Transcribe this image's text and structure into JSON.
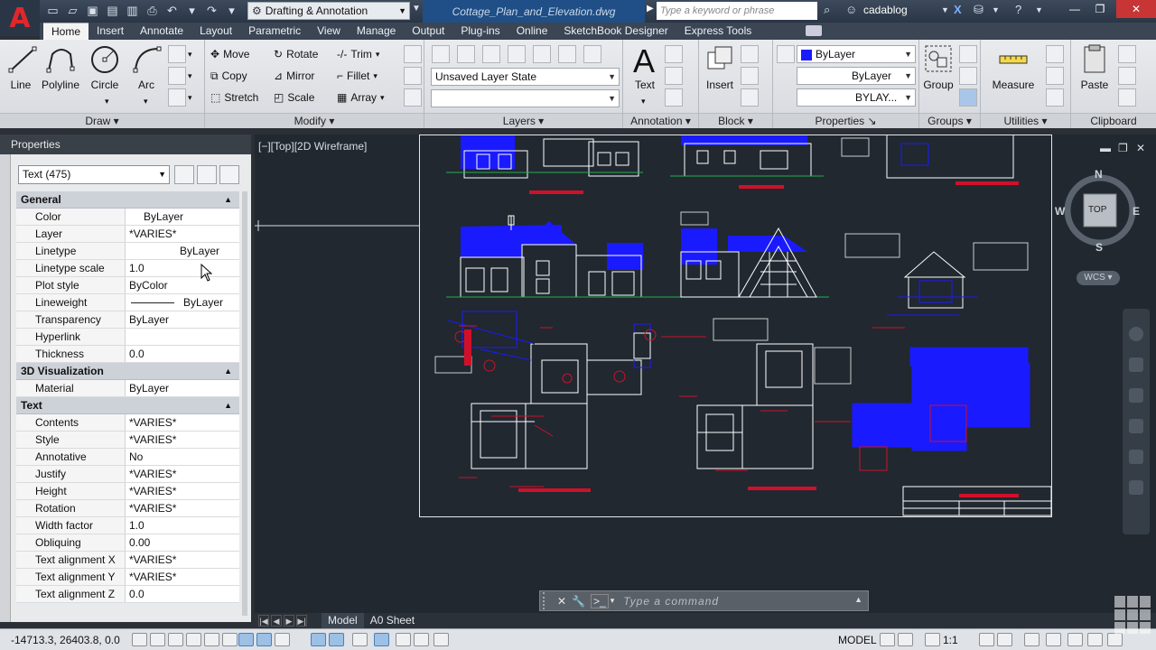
{
  "titlebar": {
    "workspace": "Drafting & Annotation",
    "document": "Cottage_Plan_and_Elevation.dwg",
    "search_placeholder": "Type a keyword or phrase",
    "user": "cadablog"
  },
  "ribbon": {
    "tabs": [
      "Home",
      "Insert",
      "Annotate",
      "Layout",
      "Parametric",
      "View",
      "Manage",
      "Output",
      "Plug-ins",
      "Online",
      "SketchBook Designer",
      "Express Tools"
    ],
    "active_tab": "Home",
    "draw": {
      "title": "Draw",
      "line": "Line",
      "polyline": "Polyline",
      "circle": "Circle",
      "arc": "Arc"
    },
    "modify": {
      "title": "Modify",
      "move": "Move",
      "rotate": "Rotate",
      "trim": "Trim",
      "copy": "Copy",
      "mirror": "Mirror",
      "fillet": "Fillet",
      "stretch": "Stretch",
      "scale": "Scale",
      "array": "Array"
    },
    "layers": {
      "title": "Layers",
      "layer_state": "Unsaved Layer State"
    },
    "annotation": {
      "title": "Annotation",
      "text": "Text"
    },
    "block": {
      "title": "Block",
      "insert": "Insert"
    },
    "properties": {
      "title": "Properties",
      "color": "ByLayer",
      "lineweight": "ByLayer",
      "linetype": "BYLAY..."
    },
    "groups": {
      "title": "Groups",
      "group": "Group"
    },
    "utilities": {
      "title": "Utilities",
      "measure": "Measure"
    },
    "clipboard": {
      "title": "Clipboard",
      "paste": "Paste"
    }
  },
  "palette": {
    "title": "Properties",
    "selector": "Text (475)",
    "sections": [
      {
        "name": "General",
        "rows": [
          {
            "k": "Color",
            "v": "ByLayer",
            "style": "color"
          },
          {
            "k": "Layer",
            "v": "*VARIES*"
          },
          {
            "k": "Linetype",
            "v": "ByLayer",
            "style": "center"
          },
          {
            "k": "Linetype scale",
            "v": "1.0"
          },
          {
            "k": "Plot style",
            "v": "ByColor"
          },
          {
            "k": "Lineweight",
            "v": "ByLayer",
            "style": "line"
          },
          {
            "k": "Transparency",
            "v": "ByLayer"
          },
          {
            "k": "Hyperlink",
            "v": ""
          },
          {
            "k": "Thickness",
            "v": "0.0"
          }
        ]
      },
      {
        "name": "3D Visualization",
        "rows": [
          {
            "k": "Material",
            "v": "ByLayer"
          }
        ]
      },
      {
        "name": "Text",
        "rows": [
          {
            "k": "Contents",
            "v": "*VARIES*"
          },
          {
            "k": "Style",
            "v": "*VARIES*"
          },
          {
            "k": "Annotative",
            "v": "No"
          },
          {
            "k": "Justify",
            "v": "*VARIES*"
          },
          {
            "k": "Height",
            "v": "*VARIES*"
          },
          {
            "k": "Rotation",
            "v": "*VARIES*"
          },
          {
            "k": "Width factor",
            "v": "1.0"
          },
          {
            "k": "Obliquing",
            "v": "0.00"
          },
          {
            "k": "Text alignment X",
            "v": "*VARIES*"
          },
          {
            "k": "Text alignment Y",
            "v": "*VARIES*"
          },
          {
            "k": "Text alignment Z",
            "v": "0.0"
          }
        ]
      }
    ]
  },
  "viewport": {
    "label": "[−][Top][2D Wireframe]",
    "viewcube": {
      "top": "TOP",
      "n": "N",
      "s": "S",
      "e": "E",
      "w": "W"
    },
    "wcs": "WCS"
  },
  "command": {
    "placeholder": "Type a command"
  },
  "layout_tabs": [
    "Model",
    "A0 Sheet"
  ],
  "status": {
    "coords": "-14713.3, 26403.8, 0.0",
    "model": "MODEL",
    "scale": "1:1"
  },
  "colors": {
    "accent_blue": "#1a1aff",
    "accent_red": "#d0102a",
    "drawing_bg": "#212830"
  }
}
